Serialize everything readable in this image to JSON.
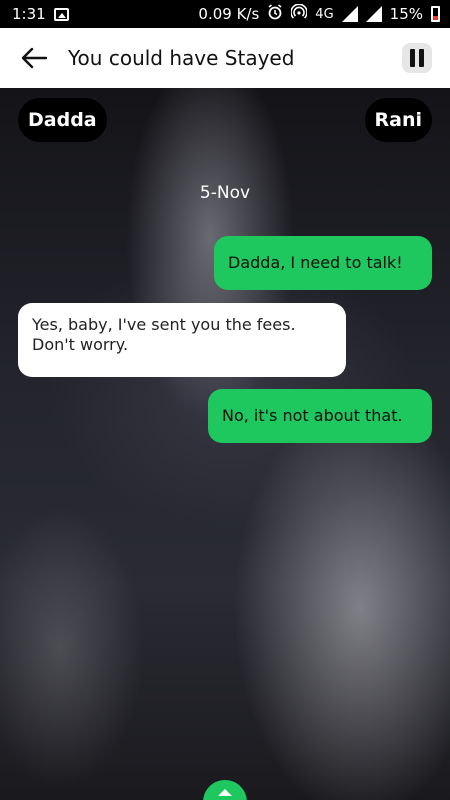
{
  "status_bar": {
    "time": "1:31",
    "network_speed": "0.09 K/s",
    "network_type": "4G",
    "battery": "15%"
  },
  "app_bar": {
    "title": "You could have Stayed"
  },
  "chat": {
    "left_participant": "Dadda",
    "right_participant": "Rani",
    "date": "5-Nov",
    "messages": [
      {
        "side": "right",
        "text": "Dadda, I need to talk!"
      },
      {
        "side": "left",
        "text": "Yes, baby, I've sent you the fees. Don't worry."
      },
      {
        "side": "right",
        "text": "No, it's not about that."
      }
    ]
  },
  "colors": {
    "accent_green": "#1fc85f",
    "battery_low": "#e53935"
  }
}
